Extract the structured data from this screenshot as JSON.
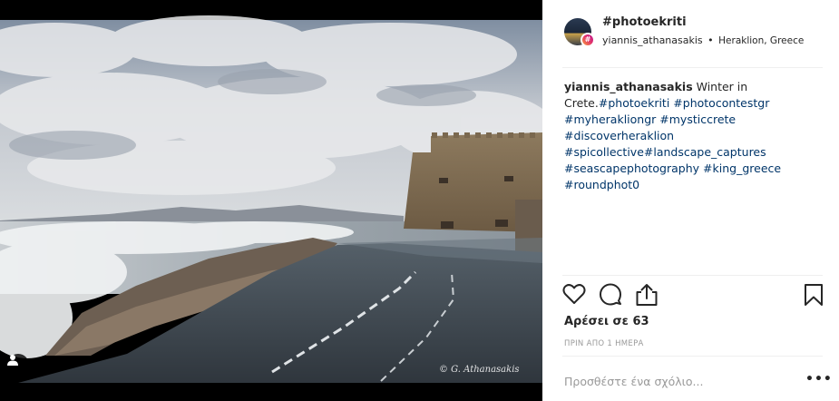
{
  "post": {
    "title": "#photoekriti",
    "username": "yiannis_athanasakis",
    "separator": "•",
    "location": "Heraklion, Greece",
    "hash_badge": "#",
    "caption": {
      "user": "yiannis_athanasakis",
      "text_1": " Winter in Crete.",
      "tags": [
        "#photoekriti",
        "#photocontestgr",
        "#myherakliongr",
        "#mysticcrete",
        "#discoverheraklion",
        "#spicollective",
        "#landscape_captures",
        "#seascapephotography",
        "#king_greece",
        "#roundphot0"
      ]
    },
    "likes_label": "Αρέσει σε 63",
    "time_label": "ΠΡΙΝ ΑΠΟ 1 ΗΜΕΡΑ",
    "comment_placeholder": "Προσθέστε ένα σχόλιο...",
    "more_label": "•••"
  },
  "photo": {
    "watermark": "© G. Athanasakis"
  },
  "icons": {
    "like": "heart-icon",
    "comment": "comment-icon",
    "share": "share-icon",
    "save": "bookmark-icon",
    "tag": "user-tag-icon"
  },
  "colors": {
    "hashtag": "#003569",
    "badge_gradient_start": "#f9a13a",
    "badge_gradient_end": "#b91d95",
    "muted": "#999999"
  }
}
